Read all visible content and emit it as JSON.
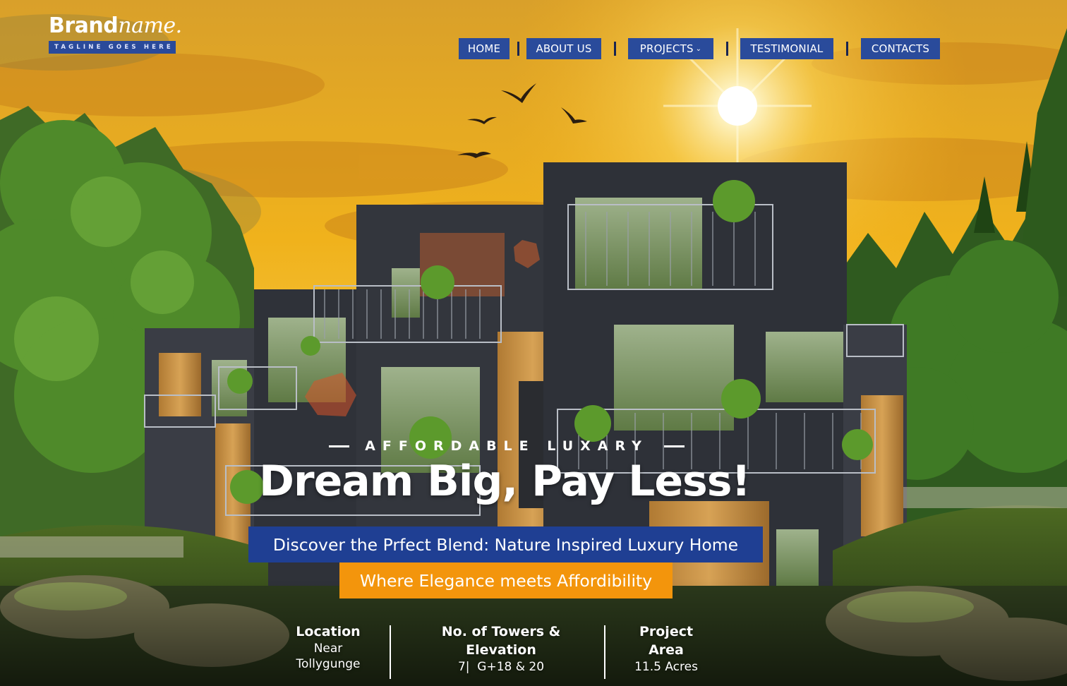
{
  "brand": {
    "name_bold": "Brand",
    "name_italic": "name.",
    "tagline": "TAGLINE GOES HERE"
  },
  "nav": {
    "items": [
      {
        "label": "HOME"
      },
      {
        "label": "ABOUT US"
      },
      {
        "label": "PROJECTS",
        "has_dropdown": true
      },
      {
        "label": "TESTIMONIAL"
      },
      {
        "label": "CONTACTS"
      }
    ],
    "dropdown_icon": "chevron-down-icon"
  },
  "hero": {
    "eyebrow": "AFFORDABLE LUXARY",
    "headline": "Dream Big, Pay Less!",
    "subheadline": "Discover the Prfect Blend: Nature Inspired Luxury Home",
    "tagline": "Where Elegance meets Affordibility"
  },
  "stats": [
    {
      "title_lines": [
        "Location"
      ],
      "value_lines": [
        "Near",
        "Tollygunge"
      ]
    },
    {
      "title_lines": [
        "No. of Towers &",
        "Elevation"
      ],
      "value_lines": [
        "7|  G+18 & 20"
      ]
    },
    {
      "title_lines": [
        "Project",
        "Area"
      ],
      "value_lines": [
        "11.5 Acres"
      ]
    }
  ],
  "colors": {
    "nav_bg": "#2a4b9b",
    "subheadline_bg": "#1f3f93",
    "tagline_bg": "#f3950c",
    "sky_top": "#e8a21a",
    "sun": "#fff6c8"
  }
}
